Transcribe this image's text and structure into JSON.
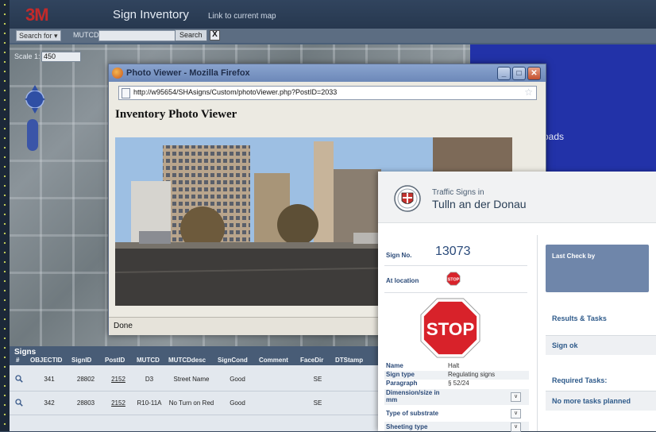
{
  "app": {
    "logo": "3M",
    "title": "Sign Inventory",
    "link": "Link to current map",
    "search_select": "Search for",
    "search_label": "MUTCD",
    "search_button": "Search",
    "clear_button": "X",
    "scale_label": "Scale 1:",
    "scale_value": "450",
    "map_blue_text": "oads"
  },
  "grid": {
    "title": "Signs",
    "columns": [
      "#",
      "OBJECTID",
      "SignID",
      "PostID",
      "MUTCD",
      "MUTCDdesc",
      "SignCond",
      "Comment",
      "FaceDir",
      "DTStamp"
    ],
    "rows": [
      {
        "objectid": "341",
        "signid": "28802",
        "postid": "2152",
        "mutcd": "D3",
        "desc": "Street Name",
        "cond": "Good",
        "comment": "",
        "facedir": "SE"
      },
      {
        "objectid": "342",
        "signid": "28803",
        "postid": "2152",
        "mutcd": "R10-11A",
        "desc": "No Turn on Red",
        "cond": "Good",
        "comment": "",
        "facedir": "SE"
      }
    ]
  },
  "popup": {
    "window_title": "Photo Viewer - Mozilla Firefox",
    "url": "http://w95654/SHAsigns/Custom/photoViewer.php?PostID=2033",
    "heading": "Inventory Photo Viewer",
    "status": "Done"
  },
  "panel": {
    "header_sub": "Traffic Signs in",
    "header_main": "Tulln an der Donau",
    "sign_no_label": "Sign No.",
    "sign_no": "13073",
    "at_location_label": "At location",
    "stop_text": "STOP",
    "attributes": [
      {
        "key": "Name",
        "value": "Halt"
      },
      {
        "key": "Sign type",
        "value": "Regulating signs"
      },
      {
        "key": "Paragraph",
        "value": "§ 52/24"
      },
      {
        "key": "Dimension/size in mm",
        "value": ""
      },
      {
        "key": "Type of substrate",
        "value": ""
      },
      {
        "key": "Sheeting type",
        "value": ""
      }
    ],
    "last_check": "Last Check by",
    "results_tasks": "Results & Tasks",
    "result_value": "Sign ok",
    "required_tasks": "Required Tasks:",
    "tasks_value": "No more tasks planned"
  }
}
